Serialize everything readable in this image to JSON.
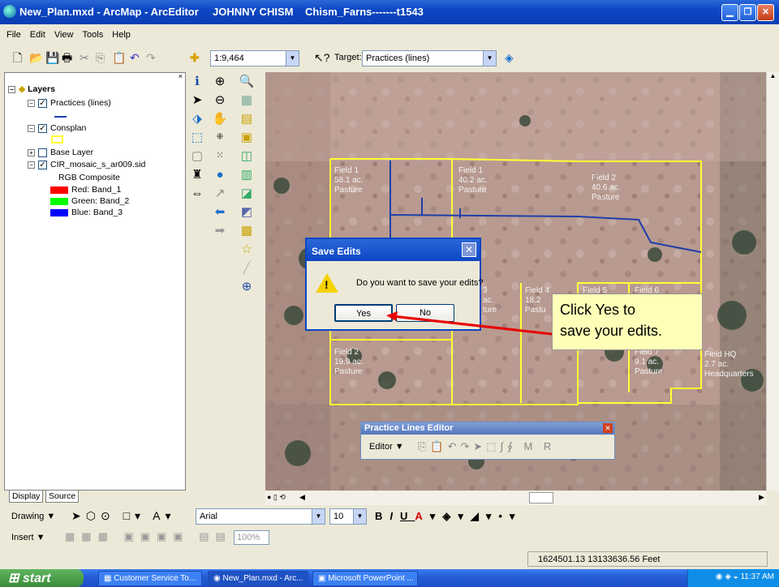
{
  "window": {
    "title": "New_Plan.mxd - ArcMap - ArcEditor",
    "user": "JOHNNY CHISM",
    "project": "Chism_Farns-------t1543"
  },
  "menu": [
    "File",
    "Edit",
    "View",
    "Tools",
    "Help"
  ],
  "toolbar": {
    "scale_value": "1:9,464",
    "target_label": "Target:",
    "target_value": "Practices (lines)"
  },
  "toc": {
    "root": "Layers",
    "layers": [
      {
        "name": "Practices (lines)"
      },
      {
        "name": "Consplan"
      },
      {
        "name": "Base Layer"
      },
      {
        "name": "CIR_mosaic_s_ar009.sid"
      }
    ],
    "rgb_label": "RGB Composite",
    "bands": [
      {
        "label": "Red:  Band_1",
        "color": "#ff0000"
      },
      {
        "label": "Green: Band_2",
        "color": "#00ff00"
      },
      {
        "label": "Blue:  Band_3",
        "color": "#0000ff"
      }
    ],
    "tabs": [
      "Display",
      "Source"
    ]
  },
  "fields": [
    {
      "text": "Field 1\n58.1 ac.\nPasture"
    },
    {
      "text": "Field 1\n40.2 ac.\nPasture"
    },
    {
      "text": "Field 2\n40.6 ac.\nPasture"
    },
    {
      "text": "Field 2\n19.9 ac.\nPasture"
    },
    {
      "text": "3\nac.\nture"
    },
    {
      "text": "Field 4\n18.2\nPastu"
    },
    {
      "text": "Field 5\n14"
    },
    {
      "text": "Field 6"
    },
    {
      "text": "Field 7\n9.1 ac.\nPasture"
    },
    {
      "text": "Field HQ\n2.7 ac.\nHeadquarters"
    }
  ],
  "dialog": {
    "title": "Save Edits",
    "message": "Do you want to save your edits?",
    "yes": "Yes",
    "no": "No"
  },
  "callout": {
    "line1": "Click Yes to",
    "line2": "save your edits."
  },
  "practice_editor": {
    "title": "Practice Lines Editor",
    "editor_label": "Editor ▼"
  },
  "drawing": {
    "drawing_label": "Drawing ▼",
    "font": "Arial",
    "size": "10",
    "insert_label": "Insert ▼",
    "zoom": "100%"
  },
  "status": {
    "coords": "1624501.13  13133636.56 Feet"
  },
  "taskbar": {
    "start": "start",
    "tasks": [
      "Customer Service To...",
      "New_Plan.mxd - Arc...",
      "Microsoft PowerPoint ..."
    ],
    "clock": "11:37 AM"
  },
  "colors": {
    "title_blue": "#0d47c4",
    "field_boundary": "#ffff33",
    "practice_line": "#1f3fa8",
    "callout": "#ffffb7"
  }
}
